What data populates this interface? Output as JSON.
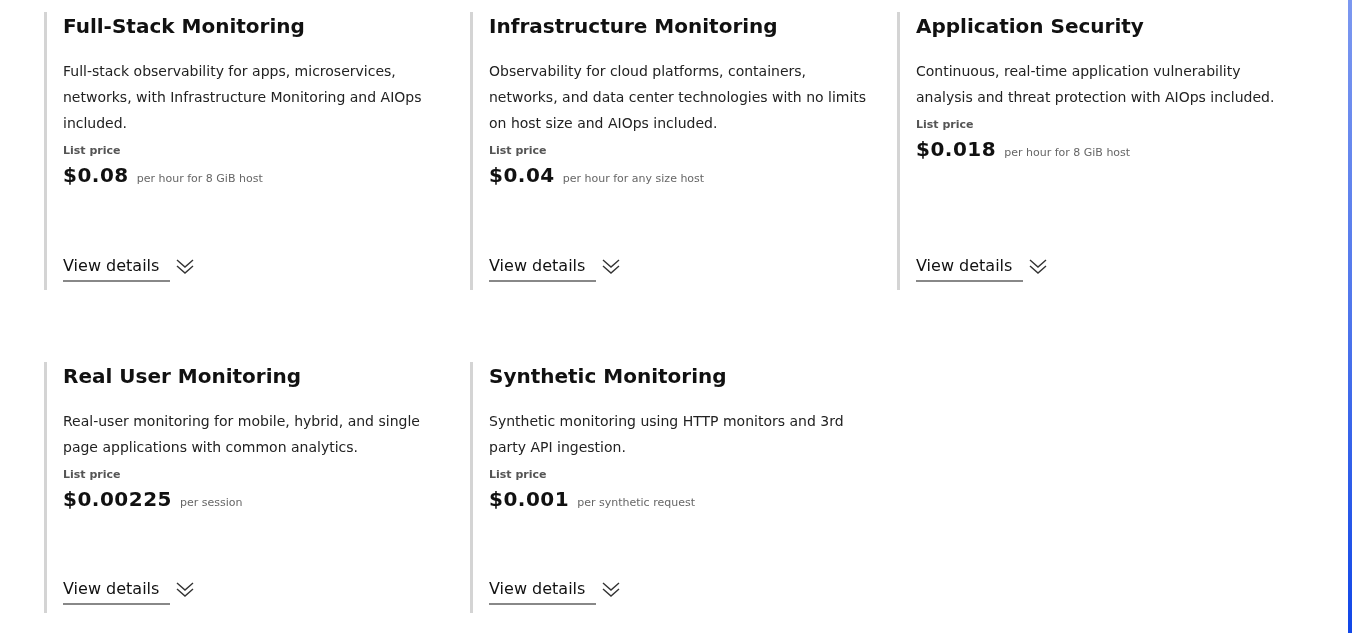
{
  "products": [
    {
      "title": "Full-Stack Monitoring",
      "description": "Full-stack observability for apps, microservices, networks, with Infrastructure Monitoring and AIOps included.",
      "price_label": "List price",
      "price": "$0.08",
      "unit": "per hour for 8 GiB host",
      "link": "View details"
    },
    {
      "title": "Infrastructure Monitoring",
      "description": "Observability for cloud platforms, containers, networks, and data center technologies with no limits on host size and AIOps included.",
      "price_label": "List price",
      "price": "$0.04",
      "unit": "per hour for any size host",
      "link": "View details"
    },
    {
      "title": "Application Security",
      "description": "Continuous, real-time application vulnerability analysis and threat protection with AIOps included.",
      "price_label": "List price",
      "price": "$0.018",
      "unit": "per hour for 8 GiB host",
      "link": "View details"
    },
    {
      "title": "Real User Monitoring",
      "description": "Real-user monitoring for mobile, hybrid, and single page applications with common analytics.",
      "price_label": "List price",
      "price": "$0.00225",
      "unit": "per session",
      "link": "View details"
    },
    {
      "title": "Synthetic Monitoring",
      "description": "Synthetic monitoring using HTTP monitors and 3rd party API ingestion.",
      "price_label": "List price",
      "price": "$0.001",
      "unit": "per synthetic request",
      "link": "View details"
    }
  ]
}
